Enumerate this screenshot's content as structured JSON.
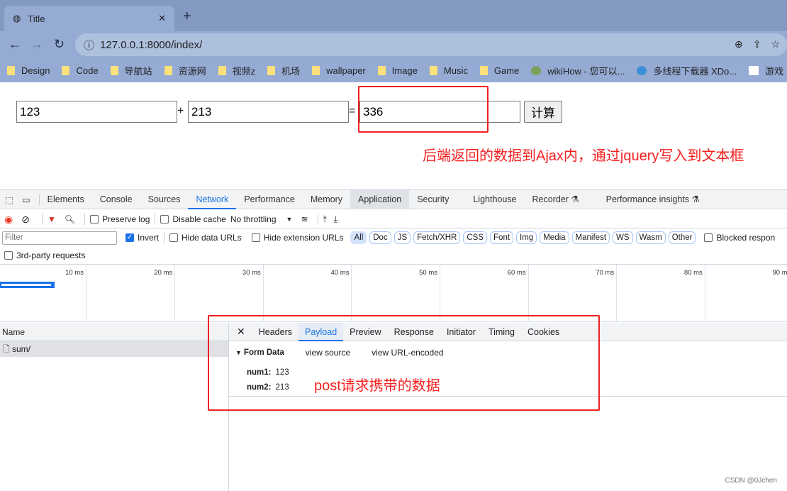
{
  "browser": {
    "tab_title": "Title",
    "url": "127.0.0.1:8000/index/",
    "bookmarks": [
      "Design",
      "Code",
      "导航站",
      "资源网",
      "视频z",
      "机场",
      "wallpaper",
      "Image",
      "Music",
      "Game",
      "wikiHow - 您可以...",
      "多线程下载器 XDo...",
      "游戏"
    ]
  },
  "page": {
    "num1": "123",
    "plus": "+",
    "num2": "213",
    "equals": "=",
    "result": "336",
    "calc_button": "计算",
    "annotation": "后端返回的数据到Ajax内，通过jquery写入到文本框"
  },
  "devtools": {
    "tabs": [
      "Elements",
      "Console",
      "Sources",
      "Network",
      "Performance",
      "Memory",
      "Application",
      "Security",
      "Lighthouse",
      "Recorder ⚗",
      "Performance insights ⚗"
    ],
    "active_tab": "Network",
    "toolbar": {
      "preserve_log": "Preserve log",
      "disable_cache": "Disable cache",
      "throttling": "No throttling"
    },
    "filter": {
      "placeholder": "Filter",
      "invert": "Invert",
      "hide_data": "Hide data URLs",
      "hide_ext": "Hide extension URLs",
      "types": [
        "All",
        "Doc",
        "JS",
        "Fetch/XHR",
        "CSS",
        "Font",
        "Img",
        "Media",
        "Manifest",
        "WS",
        "Wasm",
        "Other"
      ],
      "blocked": "Blocked respon",
      "third_party": "3rd-party requests"
    },
    "timeline_ticks": [
      "10 ms",
      "20 ms",
      "30 ms",
      "40 ms",
      "50 ms",
      "60 ms",
      "70 ms",
      "80 ms",
      "90 ms"
    ],
    "name_header": "Name",
    "requests": [
      "sum/"
    ],
    "detail_tabs": [
      "Headers",
      "Payload",
      "Preview",
      "Response",
      "Initiator",
      "Timing",
      "Cookies"
    ],
    "active_detail": "Payload",
    "form_data": {
      "title": "Form Data",
      "view_source": "view source",
      "view_url": "view URL-encoded",
      "fields": [
        {
          "key": "num1:",
          "value": "123"
        },
        {
          "key": "num2:",
          "value": "213"
        }
      ]
    },
    "annotation": "post请求携带的数据"
  },
  "watermark": "CSDN @0Jchen",
  "colors": {
    "accent": "#1a73e8",
    "annotation": "#f52020",
    "chrome": "#8399c1"
  }
}
